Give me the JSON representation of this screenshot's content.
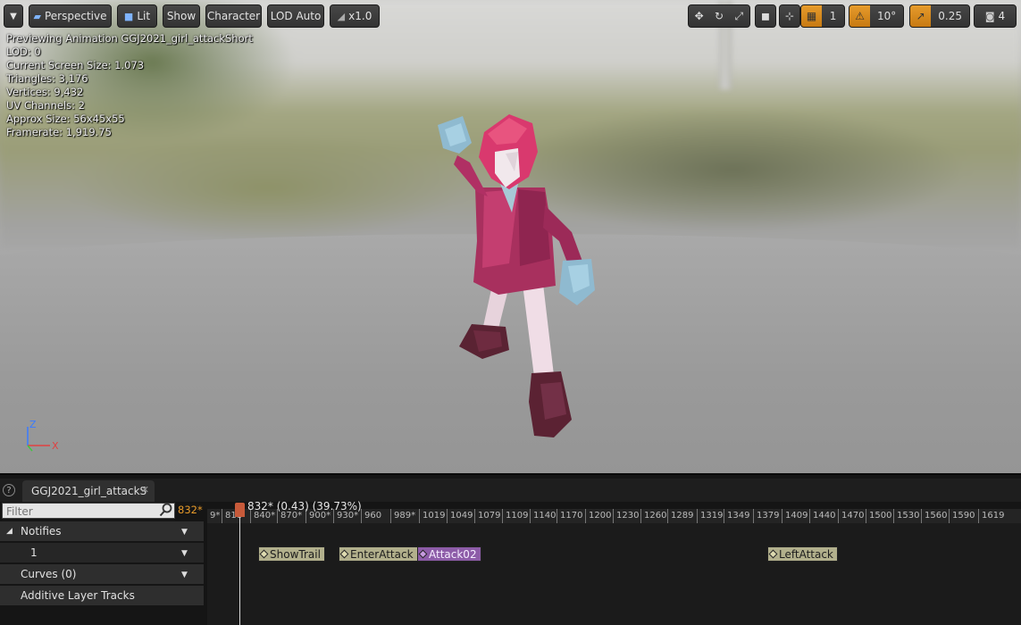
{
  "toolbar": {
    "menu_icon": "chevron-down-icon",
    "perspective_label": "Perspective",
    "lit_label": "Lit",
    "show_label": "Show",
    "character_label": "Character",
    "lod_label": "LOD Auto",
    "speed_label": "x1.0",
    "grid_size": "1",
    "rotation_snap": "10°",
    "scale_snap": "0.25",
    "camera_speed": "4"
  },
  "stats": {
    "line1": "Previewing Animation GGJ2021_girl_attackShort",
    "line2": "LOD: 0",
    "line3": "Current Screen Size: 1.073",
    "line4": "Triangles: 3,176",
    "line5": "Vertices: 9,432",
    "line6": "UV Channels: 2",
    "line7": "Approx Size: 56x45x55",
    "line8": "Framerate: 1,919.75"
  },
  "axes": {
    "z": "Z",
    "x": "X",
    "z_color": "#3a7bff",
    "x_color": "#e04040",
    "y_color": "#3fc83f"
  },
  "panel": {
    "help": "?",
    "tab_label": "GGJ2021_girl_attackS",
    "tab_close": "✕",
    "filter_placeholder": "Filter",
    "current_frame": "832*",
    "tracks": [
      {
        "label": "Notifies"
      },
      {
        "label": "1"
      },
      {
        "label": "Curves  (0)"
      },
      {
        "label": "Additive Layer Tracks"
      }
    ]
  },
  "timeline": {
    "playhead": "832* (0.43) (39.73%)",
    "ticks": [
      "9*",
      "818",
      "840*",
      "870*",
      "900*",
      "930*",
      "960",
      "989*",
      "1019",
      "1049",
      "1079",
      "1109",
      "1140",
      "1170",
      "1200",
      "1230",
      "1260",
      "1289",
      "1319",
      "1349",
      "1379",
      "1409",
      "1440",
      "1470",
      "1500",
      "1530",
      "1560",
      "1590",
      "1619"
    ],
    "notifies": [
      {
        "label": "ShowTrail",
        "style": "normal"
      },
      {
        "label": "EnterAttack",
        "style": "normal"
      },
      {
        "label": "Attack02",
        "style": "purple"
      },
      {
        "label": "LeftAttack",
        "style": "normal"
      }
    ]
  },
  "colors": {
    "accent_orange": "#e69b2c",
    "notify_normal": "#b2b08c",
    "notify_purple": "#8d5ca8",
    "playhead": "#c75a3a"
  }
}
